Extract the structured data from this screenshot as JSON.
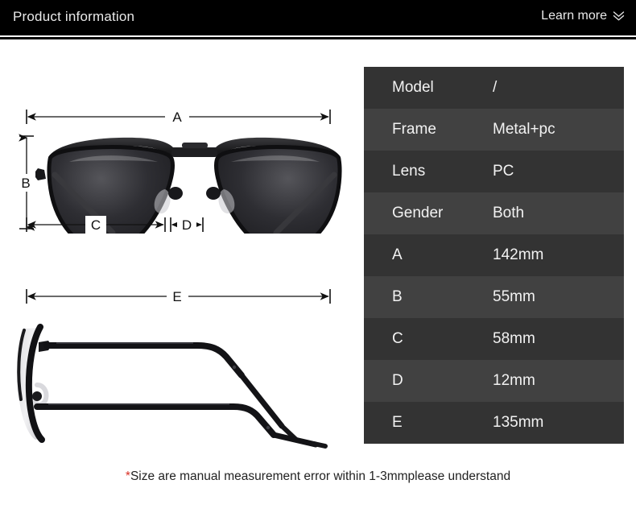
{
  "header": {
    "title": "Product information",
    "learn_more_label": "Learn more",
    "chevron_icon": "double-chevron-down-icon",
    "background_color": "#000000",
    "text_color": "#e9e9e9"
  },
  "diagram": {
    "front_view": {
      "name": "sunglasses-front-view",
      "dimension_labels": {
        "a": "A",
        "b": "B",
        "c": "C",
        "d": "D"
      }
    },
    "side_view": {
      "name": "sunglasses-side-view",
      "dimension_labels": {
        "e": "E"
      }
    }
  },
  "spec_table": {
    "row_colors": {
      "dark": "#333333",
      "light": "#414141"
    },
    "rows": [
      {
        "label": "Model",
        "value": "/"
      },
      {
        "label": "Frame",
        "value": "Metal+pc"
      },
      {
        "label": "Lens",
        "value": "PC"
      },
      {
        "label": "Gender",
        "value": "Both"
      },
      {
        "label": "A",
        "value": "142mm"
      },
      {
        "label": "B",
        "value": "55mm"
      },
      {
        "label": "C",
        "value": "58mm"
      },
      {
        "label": "D",
        "value": "12mm"
      },
      {
        "label": "E",
        "value": "135mm"
      }
    ]
  },
  "footnote": {
    "asterisk": "*",
    "text": "Size are manual measurement error within 1-3mmplease understand",
    "asterisk_color": "#d93025"
  }
}
